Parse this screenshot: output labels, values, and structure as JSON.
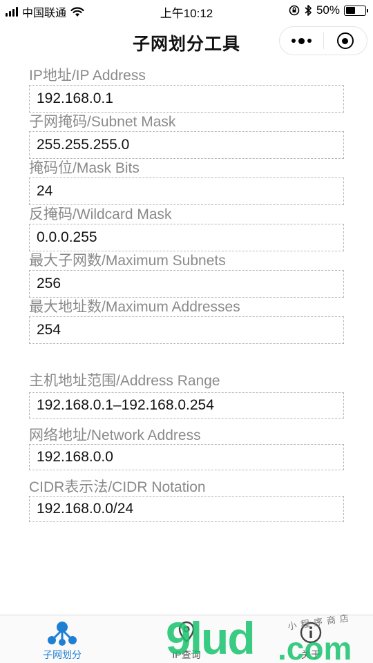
{
  "status_bar": {
    "carrier": "中国联通",
    "time": "上午10:12",
    "battery_text": "50%",
    "battery_level": 0.5
  },
  "nav": {
    "title": "子网划分工具",
    "more_icon": "more-dots-icon",
    "close_icon": "target-circle-icon"
  },
  "fields": [
    {
      "label": "IP地址/IP Address",
      "value": "192.168.0.1"
    },
    {
      "label": "子网掩码/Subnet Mask",
      "value": "255.255.255.0"
    },
    {
      "label": "掩码位/Mask Bits",
      "value": "24"
    },
    {
      "label": "反掩码/Wildcard Mask",
      "value": "0.0.0.255"
    },
    {
      "label": "最大子网数/Maximum Subnets",
      "value": "256"
    },
    {
      "label": "最大地址数/Maximum Addresses",
      "value": "254"
    }
  ],
  "results": [
    {
      "label": "主机地址范围/Address Range",
      "value": "192.168.0.1–192.168.0.254"
    },
    {
      "label": "网络地址/Network Address",
      "value": "192.168.0.0"
    },
    {
      "label": "CIDR表示法/CIDR Notation",
      "value": "192.168.0.0/24"
    }
  ],
  "tabs": [
    {
      "label": "子网划分",
      "icon": "network-nodes-icon",
      "active": true
    },
    {
      "label": "IP查询",
      "icon": "location-pin-icon",
      "active": false
    },
    {
      "label": "关于",
      "icon": "info-icon",
      "active": false
    }
  ],
  "watermark": {
    "main": "9lud",
    "suffix": ".com",
    "small": "小程序商店"
  },
  "colors": {
    "accent": "#1e7fd3",
    "label_gray": "#8a8a8a",
    "watermark_green": "#19c36f"
  }
}
